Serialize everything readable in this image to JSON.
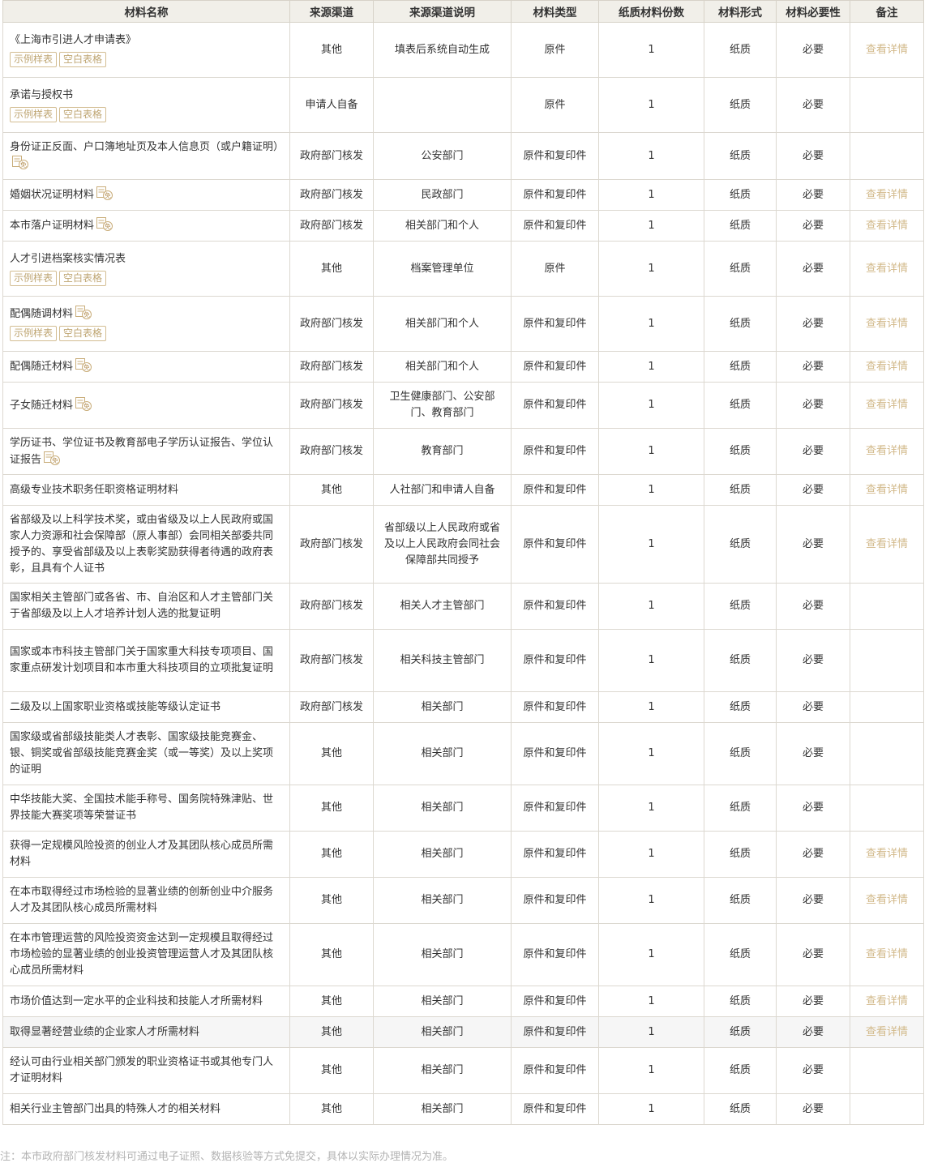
{
  "headers": [
    "材料名称",
    "来源渠道",
    "来源渠道说明",
    "材料类型",
    "纸质材料份数",
    "材料形式",
    "材料必要性",
    "备注"
  ],
  "tag_example": "示例样表",
  "tag_blank": "空白表格",
  "detail_link": "查看详情",
  "rows": [
    {
      "name": "《上海市引进人才申请表》",
      "source": "其他",
      "desc": "填表后系统自动生成",
      "type": "原件",
      "copies": "1",
      "form": "纸质",
      "need": "必要",
      "note": "查看详情",
      "tags": true,
      "mian": false
    },
    {
      "name": "承诺与授权书",
      "source": "申请人自备",
      "desc": "",
      "type": "原件",
      "copies": "1",
      "form": "纸质",
      "need": "必要",
      "note": "",
      "tags": true,
      "mian": false
    },
    {
      "name": "身份证正反面、户口簿地址页及本人信息页（或户籍证明）",
      "source": "政府部门核发",
      "desc": "公安部门",
      "type": "原件和复印件",
      "copies": "1",
      "form": "纸质",
      "need": "必要",
      "note": "",
      "tags": false,
      "mian": true
    },
    {
      "name": "婚姻状况证明材料",
      "source": "政府部门核发",
      "desc": "民政部门",
      "type": "原件和复印件",
      "copies": "1",
      "form": "纸质",
      "need": "必要",
      "note": "查看详情",
      "tags": false,
      "mian": true
    },
    {
      "name": "本市落户证明材料",
      "source": "政府部门核发",
      "desc": "相关部门和个人",
      "type": "原件和复印件",
      "copies": "1",
      "form": "纸质",
      "need": "必要",
      "note": "查看详情",
      "tags": false,
      "mian": true
    },
    {
      "name": "人才引进档案核实情况表",
      "source": "其他",
      "desc": "档案管理单位",
      "type": "原件",
      "copies": "1",
      "form": "纸质",
      "need": "必要",
      "note": "查看详情",
      "tags": true,
      "mian": false
    },
    {
      "name": "配偶随调材料",
      "source": "政府部门核发",
      "desc": "相关部门和个人",
      "type": "原件和复印件",
      "copies": "1",
      "form": "纸质",
      "need": "必要",
      "note": "查看详情",
      "tags": true,
      "mian": true
    },
    {
      "name": "配偶随迁材料",
      "source": "政府部门核发",
      "desc": "相关部门和个人",
      "type": "原件和复印件",
      "copies": "1",
      "form": "纸质",
      "need": "必要",
      "note": "查看详情",
      "tags": false,
      "mian": true
    },
    {
      "name": "子女随迁材料",
      "source": "政府部门核发",
      "desc": "卫生健康部门、公安部门、教育部门",
      "type": "原件和复印件",
      "copies": "1",
      "form": "纸质",
      "need": "必要",
      "note": "查看详情",
      "tags": false,
      "mian": true
    },
    {
      "name": "学历证书、学位证书及教育部电子学历认证报告、学位认证报告",
      "source": "政府部门核发",
      "desc": "教育部门",
      "type": "原件和复印件",
      "copies": "1",
      "form": "纸质",
      "need": "必要",
      "note": "查看详情",
      "tags": false,
      "mian": true
    },
    {
      "name": "高级专业技术职务任职资格证明材料",
      "source": "其他",
      "desc": "人社部门和申请人自备",
      "type": "原件和复印件",
      "copies": "1",
      "form": "纸质",
      "need": "必要",
      "note": "查看详情",
      "tags": false,
      "mian": false
    },
    {
      "name": "省部级及以上科学技术奖，或由省级及以上人民政府或国家人力资源和社会保障部（原人事部）会同相关部委共同授予的、享受省部级及以上表彰奖励获得者待遇的政府表彰，且具有个人证书",
      "source": "政府部门核发",
      "desc": "省部级以上人民政府或省及以上人民政府会同社会保障部共同授予",
      "type": "原件和复印件",
      "copies": "1",
      "form": "纸质",
      "need": "必要",
      "note": "查看详情",
      "tags": false,
      "mian": false
    },
    {
      "name": "国家相关主管部门或各省、市、自治区和人才主管部门关于省部级及以上人才培养计划人选的批复证明",
      "source": "政府部门核发",
      "desc": "相关人才主管部门",
      "type": "原件和复印件",
      "copies": "1",
      "form": "纸质",
      "need": "必要",
      "note": "",
      "tags": false,
      "mian": false
    },
    {
      "name": "国家或本市科技主管部门关于国家重大科技专项项目、国家重点研发计划项目和本市重大科技项目的立项批复证明",
      "source": "政府部门核发",
      "desc": "相关科技主管部门",
      "type": "原件和复印件",
      "copies": "1",
      "form": "纸质",
      "need": "必要",
      "note": "",
      "tags": false,
      "mian": false
    },
    {
      "name": "二级及以上国家职业资格或技能等级认定证书",
      "source": "政府部门核发",
      "desc": "相关部门",
      "type": "原件和复印件",
      "copies": "1",
      "form": "纸质",
      "need": "必要",
      "note": "",
      "tags": false,
      "mian": false
    },
    {
      "name": "国家级或省部级技能类人才表彰、国家级技能竞赛金、银、铜奖或省部级技能竞赛金奖（或一等奖）及以上奖项的证明",
      "source": "其他",
      "desc": "相关部门",
      "type": "原件和复印件",
      "copies": "1",
      "form": "纸质",
      "need": "必要",
      "note": "",
      "tags": false,
      "mian": false
    },
    {
      "name": "中华技能大奖、全国技术能手称号、国务院特殊津贴、世界技能大赛奖项等荣誉证书",
      "source": "其他",
      "desc": "相关部门",
      "type": "原件和复印件",
      "copies": "1",
      "form": "纸质",
      "need": "必要",
      "note": "",
      "tags": false,
      "mian": false
    },
    {
      "name": "获得一定规模风险投资的创业人才及其团队核心成员所需材料",
      "source": "其他",
      "desc": "相关部门",
      "type": "原件和复印件",
      "copies": "1",
      "form": "纸质",
      "need": "必要",
      "note": "查看详情",
      "tags": false,
      "mian": false
    },
    {
      "name": "在本市取得经过市场检验的显著业绩的创新创业中介服务人才及其团队核心成员所需材料",
      "source": "其他",
      "desc": "相关部门",
      "type": "原件和复印件",
      "copies": "1",
      "form": "纸质",
      "need": "必要",
      "note": "查看详情",
      "tags": false,
      "mian": false
    },
    {
      "name": "在本市管理运营的风险投资资金达到一定规模且取得经过市场检验的显著业绩的创业投资管理运营人才及其团队核心成员所需材料",
      "source": "其他",
      "desc": "相关部门",
      "type": "原件和复印件",
      "copies": "1",
      "form": "纸质",
      "need": "必要",
      "note": "查看详情",
      "tags": false,
      "mian": false
    },
    {
      "name": "市场价值达到一定水平的企业科技和技能人才所需材料",
      "source": "其他",
      "desc": "相关部门",
      "type": "原件和复印件",
      "copies": "1",
      "form": "纸质",
      "need": "必要",
      "note": "查看详情",
      "tags": false,
      "mian": false
    },
    {
      "name": "取得显著经营业绩的企业家人才所需材料",
      "source": "其他",
      "desc": "相关部门",
      "type": "原件和复印件",
      "copies": "1",
      "form": "纸质",
      "need": "必要",
      "note": "查看详情",
      "tags": false,
      "mian": false,
      "highlight": true
    },
    {
      "name": "经认可由行业相关部门颁发的职业资格证书或其他专门人才证明材料",
      "source": "其他",
      "desc": "相关部门",
      "type": "原件和复印件",
      "copies": "1",
      "form": "纸质",
      "need": "必要",
      "note": "",
      "tags": false,
      "mian": false
    },
    {
      "name": "相关行业主管部门出具的特殊人才的相关材料",
      "source": "其他",
      "desc": "相关部门",
      "type": "原件和复印件",
      "copies": "1",
      "form": "纸质",
      "need": "必要",
      "note": "",
      "tags": false,
      "mian": false
    }
  ],
  "footnote": "注：本市政府部门核发材料可通过电子证照、数据核验等方式免提交，具体以实际办理情况为准。",
  "colors": {
    "header_bg": "#f1efe9",
    "border": "#dcd8d0",
    "accent": "#d2b98a",
    "tag": "#bfa673"
  }
}
